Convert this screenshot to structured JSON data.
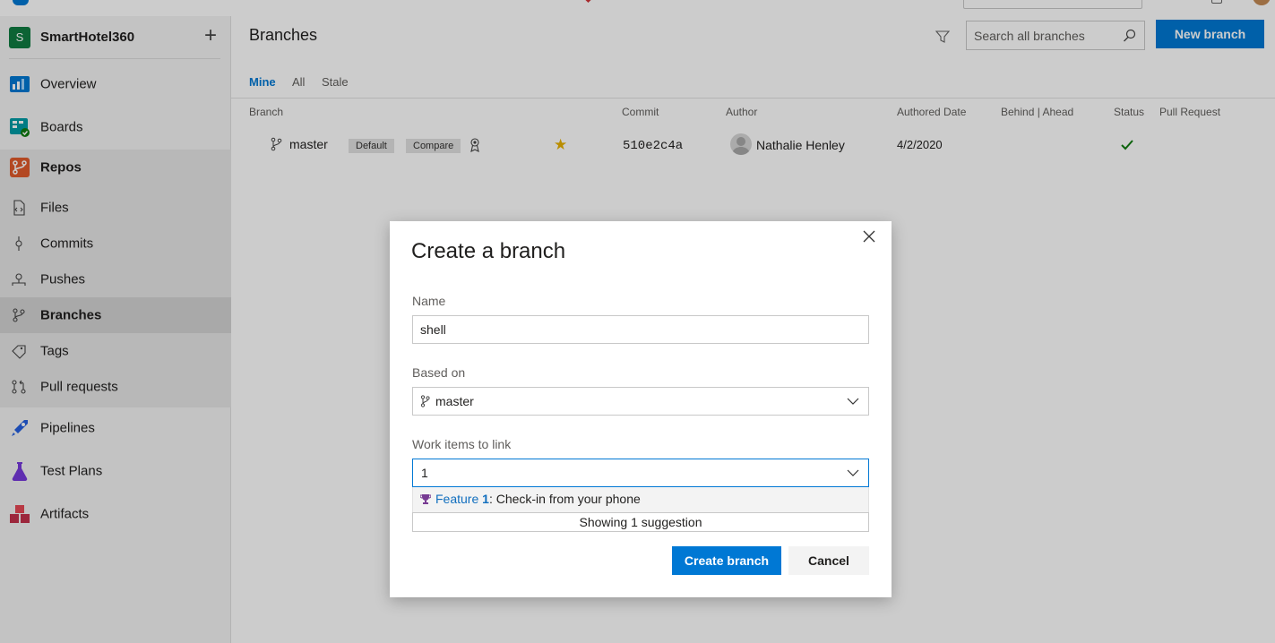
{
  "sidebar": {
    "project": {
      "initial": "S",
      "name": "SmartHotel360"
    },
    "items": [
      {
        "label": "Overview"
      },
      {
        "label": "Boards"
      },
      {
        "label": "Repos"
      },
      {
        "label": "Files"
      },
      {
        "label": "Commits"
      },
      {
        "label": "Pushes"
      },
      {
        "label": "Branches"
      },
      {
        "label": "Tags"
      },
      {
        "label": "Pull requests"
      },
      {
        "label": "Pipelines"
      },
      {
        "label": "Test Plans"
      },
      {
        "label": "Artifacts"
      }
    ]
  },
  "header": {
    "title": "Branches",
    "search_placeholder": "Search all branches",
    "new_branch_label": "New branch"
  },
  "tabs": [
    {
      "label": "Mine"
    },
    {
      "label": "All"
    },
    {
      "label": "Stale"
    }
  ],
  "table": {
    "columns": [
      "Branch",
      "Commit",
      "Author",
      "Authored Date",
      "Behind | Ahead",
      "Status",
      "Pull Request"
    ],
    "rows": [
      {
        "branch": "master",
        "tags": [
          "Default",
          "Compare"
        ],
        "commit": "510e2c4a",
        "author": "Nathalie Henley",
        "date": "4/2/2020",
        "status": "succeeded"
      }
    ]
  },
  "dialog": {
    "title": "Create a branch",
    "name_label": "Name",
    "name_value": "shell",
    "based_on_label": "Based on",
    "based_on_value": "master",
    "work_items_label": "Work items to link",
    "work_items_value": "1",
    "suggestion": {
      "type": "Feature",
      "id": "1",
      "title": ": Check-in from your phone"
    },
    "suggestion_count": "Showing 1 suggestion",
    "create_label": "Create branch",
    "cancel_label": "Cancel"
  },
  "colors": {
    "accent": "#0078d4",
    "project_badge": "#107c41",
    "favorite_star": "#e8b100",
    "status_ok": "#107c10"
  }
}
